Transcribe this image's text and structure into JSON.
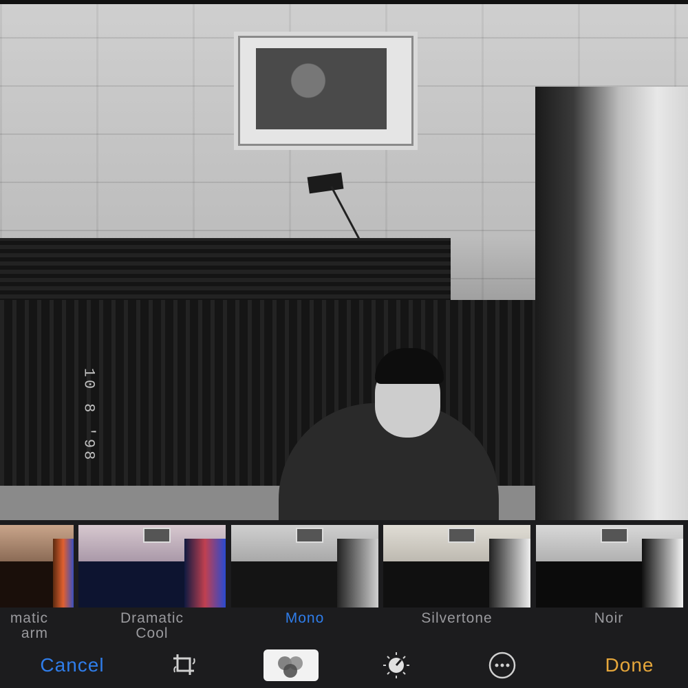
{
  "photo": {
    "timestamp": "10 8 '98"
  },
  "filters": [
    {
      "label_line1": "Dramatic",
      "label_line2": "Warm",
      "shown": "matic",
      "shown2": "arm",
      "selected": false
    },
    {
      "label_line1": "Dramatic",
      "label_line2": "Cool",
      "selected": false
    },
    {
      "label_line1": "Mono",
      "label_line2": "",
      "selected": true
    },
    {
      "label_line1": "Silvertone",
      "label_line2": "",
      "selected": false
    },
    {
      "label_line1": "Noir",
      "label_line2": "",
      "selected": false
    }
  ],
  "toolbar": {
    "cancel_label": "Cancel",
    "done_label": "Done",
    "icons": [
      "crop-rotate-icon",
      "filters-icon",
      "adjust-dial-icon",
      "more-icon"
    ]
  },
  "colors": {
    "accent_blue": "#2f7dea",
    "done_yellow": "#e6a73b",
    "strip_background": "#1c1c1e"
  }
}
